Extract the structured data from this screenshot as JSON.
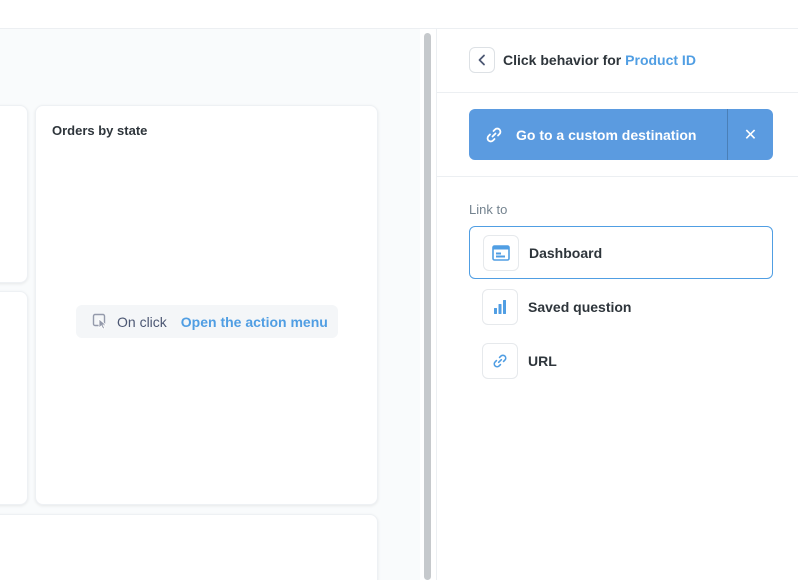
{
  "canvas": {
    "card_title": "Orders by state",
    "onclick": {
      "label": "On click",
      "action": "Open the action menu",
      "icon": "pointer-click-icon"
    }
  },
  "sidebar": {
    "back_icon": "chevron-left-icon",
    "title_prefix": "Click behavior for",
    "title_field": "Product ID",
    "destination": {
      "label": "Go to a custom destination",
      "icon": "link-icon",
      "close_symbol": "✕"
    },
    "link_to_label": "Link to",
    "options": [
      {
        "label": "Dashboard",
        "icon": "dashboard-icon",
        "selected": true
      },
      {
        "label": "Saved question",
        "icon": "bar-chart-icon",
        "selected": false
      },
      {
        "label": "URL",
        "icon": "link-icon",
        "selected": false
      }
    ]
  },
  "colors": {
    "brand": "#509ee3",
    "destination_bg": "#5b9be0",
    "text_dark": "#2e353b"
  }
}
